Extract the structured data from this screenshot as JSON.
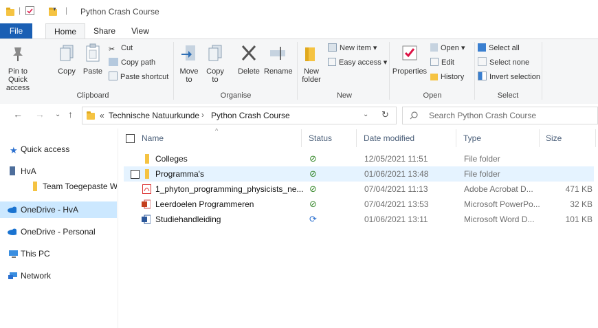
{
  "window": {
    "title": "Python Crash Course"
  },
  "tabs": [
    "File",
    "Home",
    "Share",
    "View"
  ],
  "ribbon": {
    "clipboard": {
      "pin_label": "Pin to Quick access",
      "copy_label": "Copy",
      "paste_label": "Paste",
      "cut_label": "Cut",
      "copy_path_label": "Copy path",
      "paste_shortcut_label": "Paste shortcut",
      "group_label": "Clipboard"
    },
    "organise": {
      "move_label": "Move to",
      "copy_to_label": "Copy to",
      "delete_label": "Delete",
      "rename_label": "Rename",
      "group_label": "Organise"
    },
    "new": {
      "new_folder_label": "New folder",
      "new_item_label": "New item",
      "easy_access_label": "Easy access",
      "group_label": "New"
    },
    "open": {
      "properties_label": "Properties",
      "open_label": "Open",
      "edit_label": "Edit",
      "history_label": "History",
      "group_label": "Open"
    },
    "select": {
      "select_all_label": "Select all",
      "select_none_label": "Select none",
      "invert_label": "Invert selection",
      "group_label": "Select"
    }
  },
  "address": {
    "prefix": "«",
    "crumbs": [
      "Technische Natuurkunde",
      "Python Crash Course"
    ],
    "search_placeholder": "Search Python Crash Course"
  },
  "nav": [
    {
      "label": "Quick access",
      "icon": "star-icon"
    },
    {
      "label": "HvA",
      "icon": "building-icon"
    },
    {
      "label": "Team Toegepaste W",
      "icon": "folder-icon"
    },
    {
      "label": "OneDrive - HvA",
      "icon": "cloud-icon",
      "selected": true
    },
    {
      "label": "OneDrive - Personal",
      "icon": "cloud-icon"
    },
    {
      "label": "This PC",
      "icon": "computer-icon"
    },
    {
      "label": "Network",
      "icon": "network-icon"
    }
  ],
  "columns": {
    "name": "Name",
    "status": "Status",
    "date": "Date modified",
    "type": "Type",
    "size": "Size"
  },
  "files": [
    {
      "name": "Colleges",
      "status": "ok",
      "date": "12/05/2021 11:51",
      "type": "File folder",
      "size": "",
      "icon": "folder-icon"
    },
    {
      "name": "Programma's",
      "status": "ok",
      "date": "01/06/2021 13:48",
      "type": "File folder",
      "size": "",
      "icon": "folder-icon",
      "hover": true
    },
    {
      "name": "1_phyton_programming_physicists_ne...",
      "status": "ok",
      "date": "07/04/2021 11:13",
      "type": "Adobe Acrobat D...",
      "size": "471 KB",
      "icon": "pdf-icon"
    },
    {
      "name": "Leerdoelen Programmeren",
      "status": "ok",
      "date": "07/04/2021 13:53",
      "type": "Microsoft PowerPo...",
      "size": "32 KB",
      "icon": "powerpoint-icon"
    },
    {
      "name": "Studiehandleiding",
      "status": "sync",
      "date": "01/06/2021 13:11",
      "type": "Microsoft Word D...",
      "size": "101 KB",
      "icon": "word-icon"
    }
  ],
  "colors": {
    "accent": "#1a5fb4",
    "selection": "#cce8ff",
    "hover": "#e5f3ff",
    "folder": "#f5c342"
  }
}
